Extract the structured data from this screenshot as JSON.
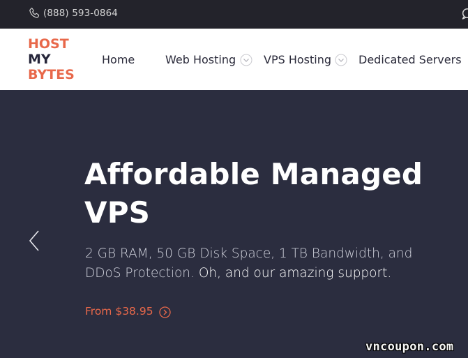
{
  "topbar": {
    "phone": "(888) 593-0864",
    "phone_icon": "phone-icon",
    "chat_icon": "chat-icon"
  },
  "logo": {
    "line1": "HOST",
    "line2": "MY",
    "line3": "BYTES"
  },
  "nav": {
    "home": "Home",
    "web_hosting": "Web Hosting",
    "vps_hosting": "VPS Hosting",
    "dedicated": "Dedicated Servers"
  },
  "hero": {
    "title": "Affordable Managed VPS",
    "subtitle_plain": "2 GB RAM, 50 GB Disk Space, 1 TB Bandwidth, and DDoS Protection.",
    "subtitle_strong": "Oh, and our amazing support.",
    "price_link": "From $38.95"
  },
  "watermark": "vncoupon.com",
  "colors": {
    "accent": "#e8684a",
    "topbar_bg": "#23232b",
    "hero_bg": "#2b2d3f",
    "nav_bg": "#ffffff"
  }
}
